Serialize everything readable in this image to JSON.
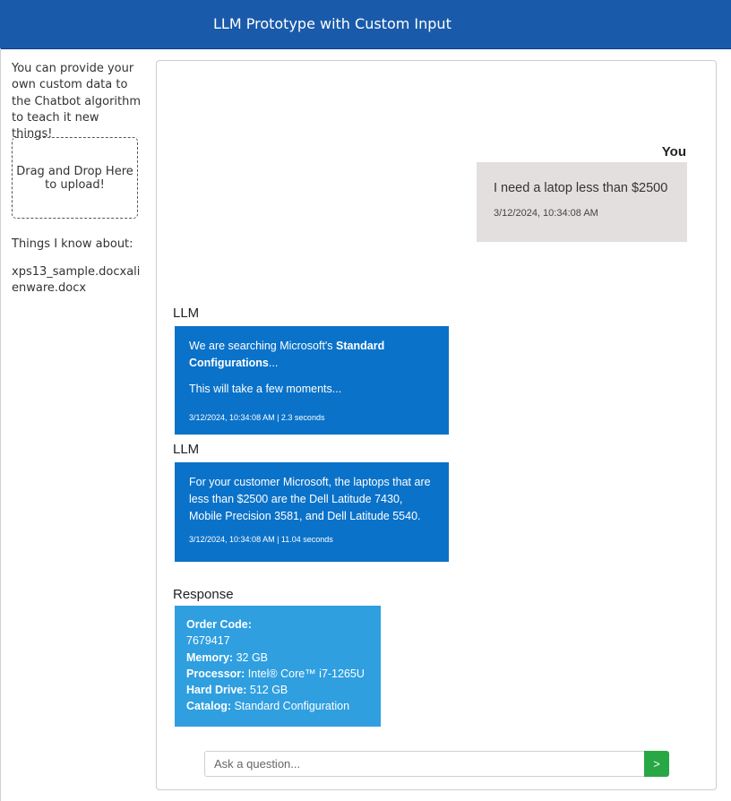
{
  "header": {
    "title": "LLM Prototype with Custom Input"
  },
  "sidebar": {
    "intro": "You can provide your own custom data to the Chatbot algorithm to teach it new things!",
    "dropzone_text": "Drag and Drop Here to upload!",
    "known_heading": "Things I know about:",
    "known_files": "xps13_sample.docxalienware.docx"
  },
  "chat": {
    "user": {
      "sender": "You",
      "text": "I need a latop less than $2500",
      "timestamp": "3/12/2024, 10:34:08 AM"
    },
    "llm1": {
      "sender": "LLM",
      "text_before": "We are searching Microsoft's ",
      "text_bold": "Standard Configurations",
      "text_after": "...",
      "text2": "This will take a few moments...",
      "timestamp": "3/12/2024, 10:34:08 AM | 2.3 seconds"
    },
    "llm2": {
      "sender": "LLM",
      "text": "For your customer Microsoft, the laptops that are less than $2500 are the Dell Latitude 7430, Mobile Precision 3581, and Dell Latitude 5540.",
      "timestamp": "3/12/2024, 10:34:08 AM | 11.04 seconds"
    },
    "response": {
      "sender": "Response",
      "order_code_label": "Order Code:",
      "order_code": "7679417",
      "memory_label": "Memory:",
      "memory": " 32 GB",
      "processor_label": "Processor:",
      "processor": " Intel® Core™ i7-1265U",
      "hard_drive_label": "Hard Drive:",
      "hard_drive": " 512 GB",
      "catalog_label": "Catalog:",
      "catalog": " Standard Configuration"
    }
  },
  "input": {
    "placeholder": "Ask a question...",
    "send_label": ">"
  },
  "colors": {
    "header": "#1a5aaa",
    "llm_bubble": "#0a72c9",
    "response_bubble": "#2f9fe0",
    "user_bubble": "#e4dfdf",
    "send_button": "#28a745"
  }
}
